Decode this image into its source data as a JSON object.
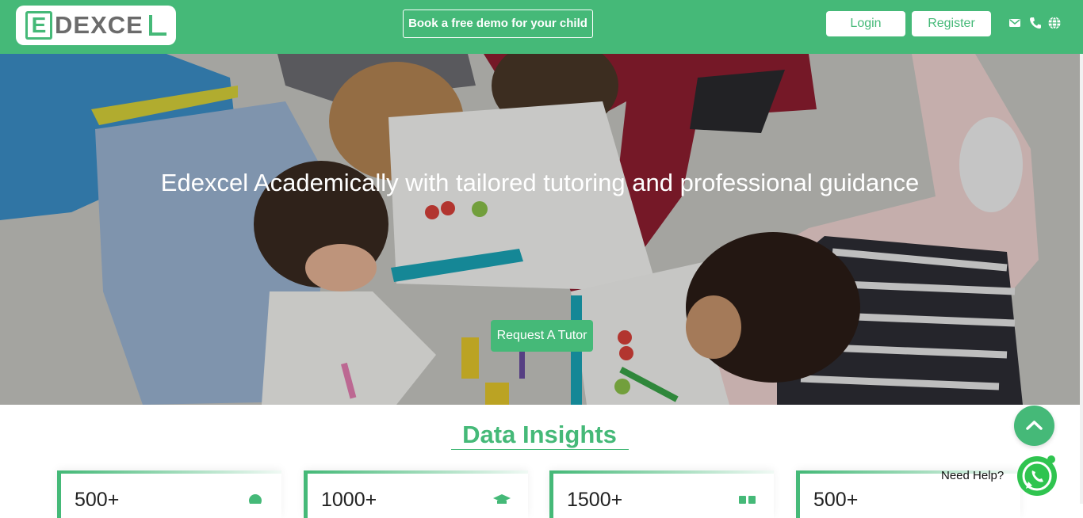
{
  "header": {
    "logo": {
      "initial": "E",
      "rest": "DEXCE"
    },
    "demo_label": "Book a free demo for your child",
    "login_label": "Login",
    "register_label": "Register",
    "icons": [
      "mail-icon",
      "phone-icon",
      "globe-icon"
    ]
  },
  "hero": {
    "title": "Edexcel Academically with tailored tutoring and professional guidance",
    "cta_label": "Request A Tutor"
  },
  "insights": {
    "title": "Data Insights",
    "stats": [
      {
        "value": "500+",
        "icon": "user-icon"
      },
      {
        "value": "1000+",
        "icon": "graduation-cap-icon"
      },
      {
        "value": "1500+",
        "icon": "grid-icon"
      },
      {
        "value": "500+",
        "icon": "book-icon"
      }
    ]
  },
  "help": {
    "label": "Need Help?"
  },
  "colors": {
    "accent": "#45b978",
    "white": "#ffffff"
  }
}
